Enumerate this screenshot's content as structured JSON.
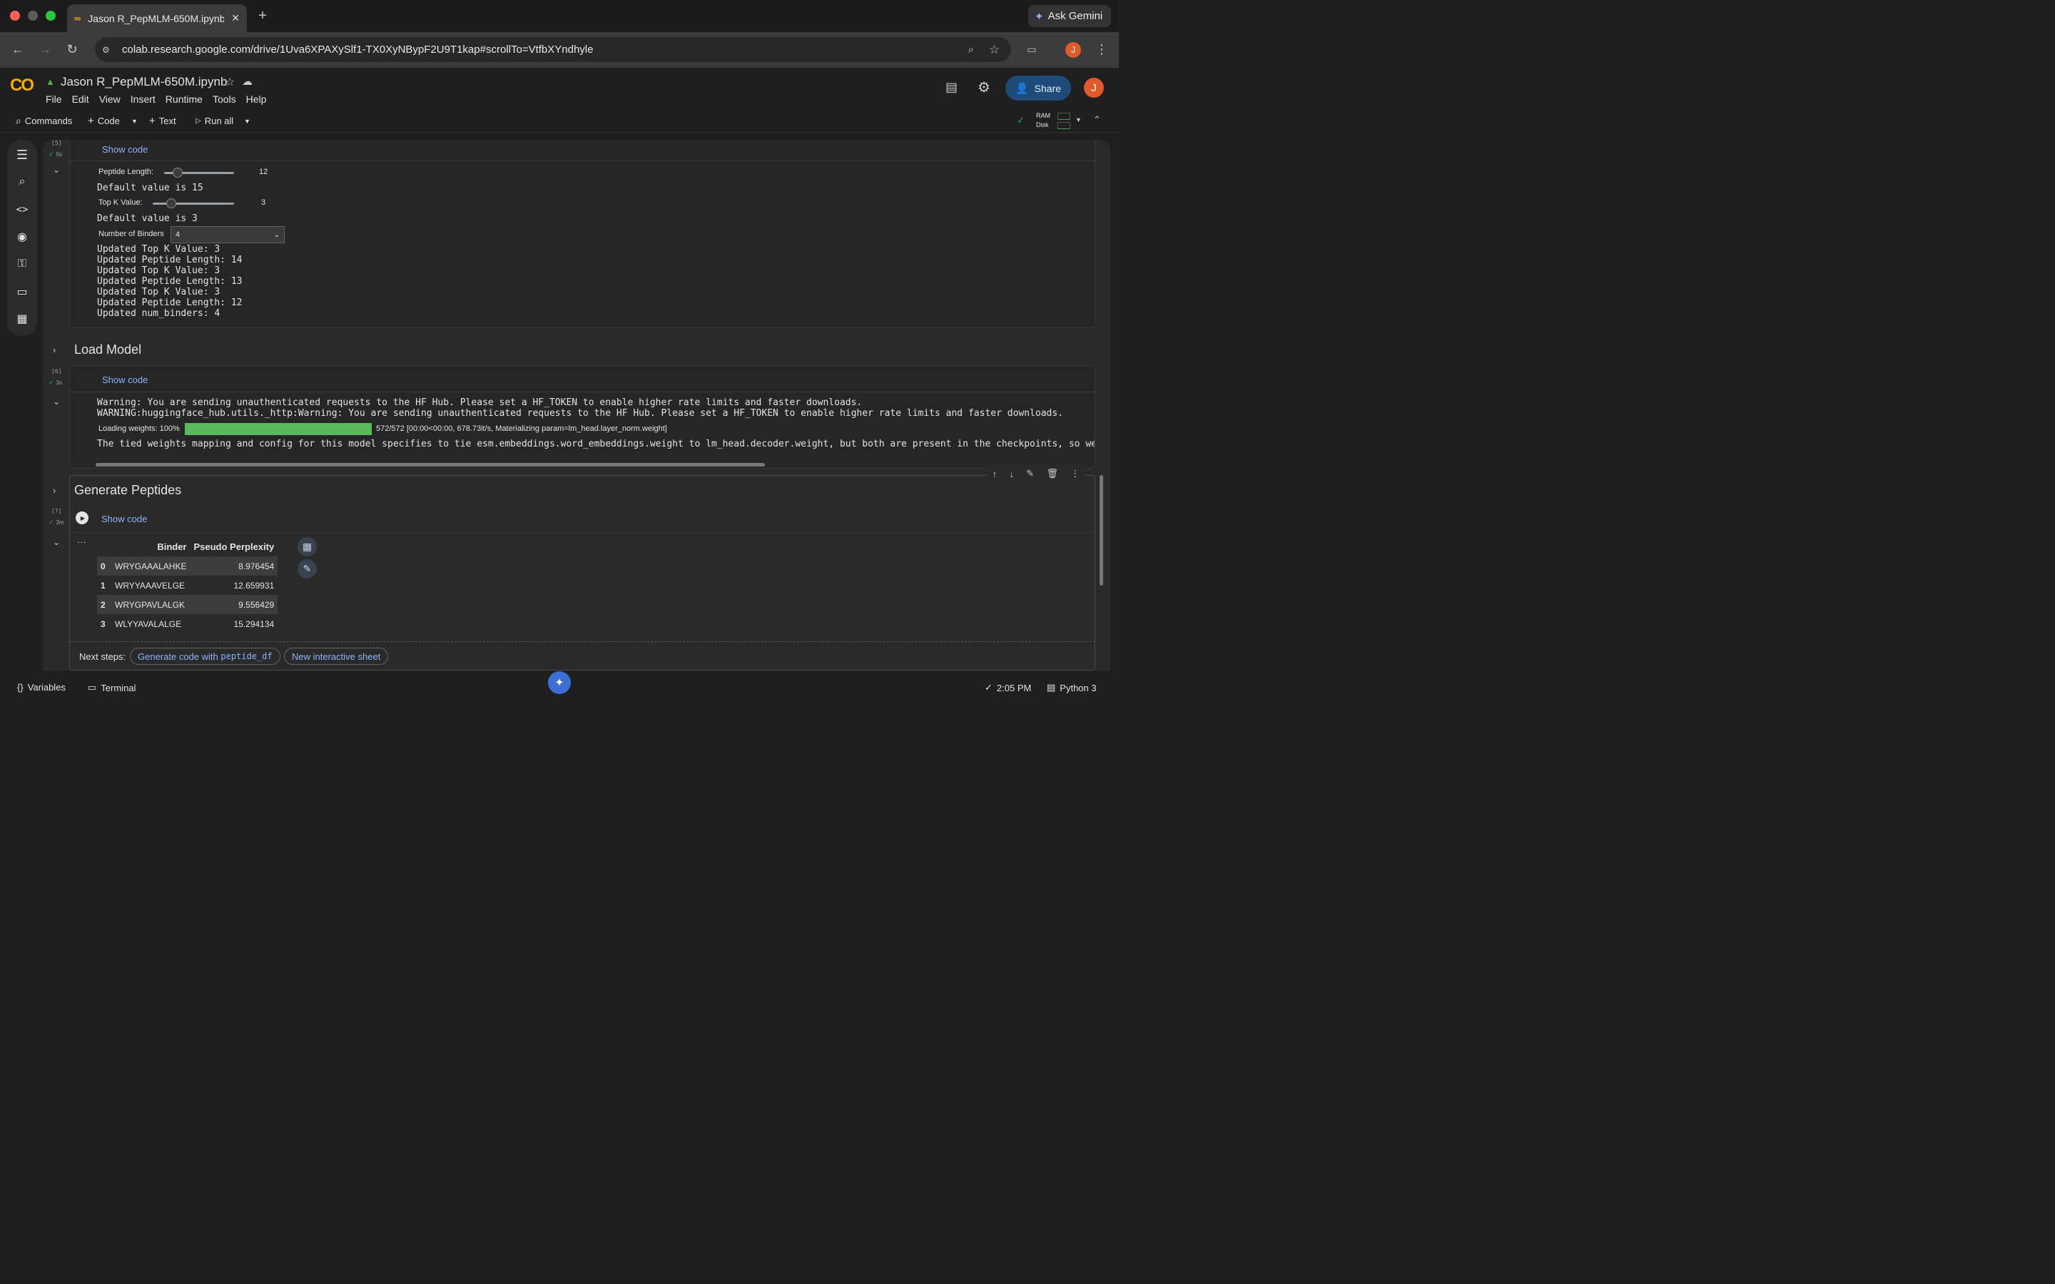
{
  "browser": {
    "tab_title": "Jason R_PepMLM-650M.ipynb",
    "url": "colab.research.google.com/drive/1Uva6XPAXySlf1-TX0XyNBypF2U9T1kap#scrollTo=VtfbXYndhyle",
    "ask_gemini": "Ask Gemini",
    "profile_initial": "J"
  },
  "colab": {
    "logo": "CO",
    "notebook_name": "Jason R_PepMLM-650M.ipynb",
    "menu": [
      "File",
      "Edit",
      "View",
      "Insert",
      "Runtime",
      "Tools",
      "Help"
    ],
    "share_label": "Share",
    "avatar_initial": "J",
    "toolbar": {
      "commands": "Commands",
      "code": "Code",
      "text": "Text",
      "run_all": "Run all",
      "ram": "RAM",
      "disk": "Disk"
    }
  },
  "cell5": {
    "exec": "[5]",
    "time": "0s",
    "show_code": "Show code",
    "peptide_length_label": "Peptide Length:",
    "peptide_length_value": "12",
    "peptide_length_fraction": 0.2,
    "default1": "Default value is 15",
    "topk_label": "Top K Value:",
    "topk_value": "3",
    "topk_fraction": 0.23,
    "default2": "Default value is 3",
    "binders_label": "Number of Binders",
    "binders_value": "4",
    "log": [
      "Updated Top K Value: 3",
      "Updated Peptide Length: 14",
      "Updated Top K Value: 3",
      "Updated Peptide Length: 13",
      "Updated Top K Value: 3",
      "Updated Peptide Length: 12",
      "Updated num_binders: 4"
    ]
  },
  "section_load": "Load Model",
  "cell6": {
    "exec": "[6]",
    "time": "3s",
    "show_code": "Show code",
    "warning1": "Warning: You are sending unauthenticated requests to the HF Hub. Please set a HF_TOKEN to enable higher rate limits and faster downloads.",
    "warning2": "WARNING:huggingface_hub.utils._http:Warning: You are sending unauthenticated requests to the HF Hub. Please set a HF_TOKEN to enable higher rate limits and faster downloads.",
    "progress_label": "Loading weights: 100%",
    "progress_fraction": 1.0,
    "progress_status": "572/572 [00:00<00:00, 678.73it/s, Materializing param=lm_head.layer_norm.weight]",
    "tied": "The tied weights mapping and config for this model specifies to tie esm.embeddings.word_embeddings.weight to lm_head.decoder.weight, but both are present in the checkpoints, so we will NOT ti"
  },
  "section_generate": "Generate Peptides",
  "cell7": {
    "exec": "[7]",
    "time": "3m",
    "show_code": "Show code",
    "table": {
      "headers": [
        "",
        "Binder",
        "Pseudo Perplexity"
      ],
      "rows": [
        [
          "0",
          "WRYGAAALAHKE",
          "8.976454"
        ],
        [
          "1",
          "WRYYAAAVELGE",
          "12.659931"
        ],
        [
          "2",
          "WRYGPAVLALGK",
          "9.556429"
        ],
        [
          "3",
          "WLYYAVALALGE",
          "15.294134"
        ]
      ]
    },
    "next_steps_label": "Next steps:",
    "next_step_1_prefix": "Generate code with ",
    "next_step_1_code": "peptide_df",
    "next_step_2": "New interactive sheet"
  },
  "statusbar": {
    "variables": "Variables",
    "terminal": "Terminal",
    "time": "2:05 PM",
    "runtime": "Python 3"
  },
  "colors": {
    "accent_blue": "#8ab4f8",
    "share_bg": "#1f4b7a",
    "progress": "#5cb85c",
    "avatar": "#e05a2b"
  }
}
